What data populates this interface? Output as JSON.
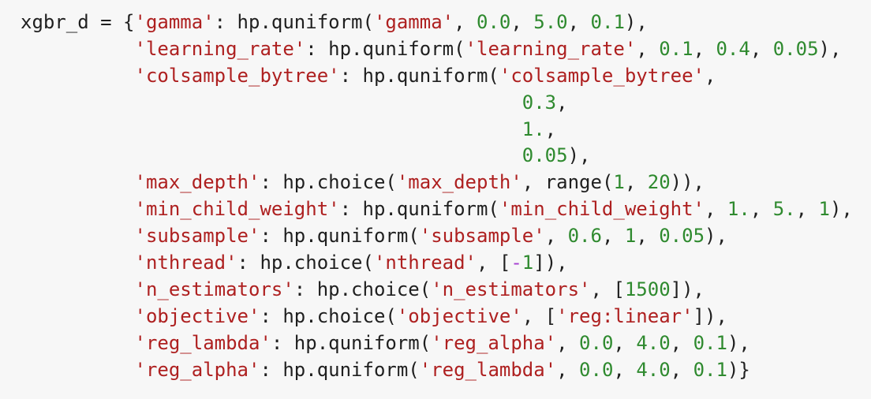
{
  "code_block": {
    "colors": {
      "background": "#f7f7f7",
      "text": "#1f1f1f",
      "string": "#ae2020",
      "number": "#2f8a2f",
      "operator": "#a63fd1"
    },
    "lines": [
      [
        {
          "k": "t",
          "v": "xgbr_d = {"
        },
        {
          "k": "s",
          "v": "'gamma'"
        },
        {
          "k": "t",
          "v": ": hp.quniform("
        },
        {
          "k": "s",
          "v": "'gamma'"
        },
        {
          "k": "t",
          "v": ", "
        },
        {
          "k": "n",
          "v": "0.0"
        },
        {
          "k": "t",
          "v": ", "
        },
        {
          "k": "n",
          "v": "5.0"
        },
        {
          "k": "t",
          "v": ", "
        },
        {
          "k": "n",
          "v": "0.1"
        },
        {
          "k": "t",
          "v": "),"
        }
      ],
      [
        {
          "k": "t",
          "v": "          "
        },
        {
          "k": "s",
          "v": "'learning_rate'"
        },
        {
          "k": "t",
          "v": ": hp.quniform("
        },
        {
          "k": "s",
          "v": "'learning_rate'"
        },
        {
          "k": "t",
          "v": ", "
        },
        {
          "k": "n",
          "v": "0.1"
        },
        {
          "k": "t",
          "v": ", "
        },
        {
          "k": "n",
          "v": "0.4"
        },
        {
          "k": "t",
          "v": ", "
        },
        {
          "k": "n",
          "v": "0.05"
        },
        {
          "k": "t",
          "v": "),"
        }
      ],
      [
        {
          "k": "t",
          "v": "          "
        },
        {
          "k": "s",
          "v": "'colsample_bytree'"
        },
        {
          "k": "t",
          "v": ": hp.quniform("
        },
        {
          "k": "s",
          "v": "'colsample_bytree'"
        },
        {
          "k": "t",
          "v": ","
        }
      ],
      [
        {
          "k": "t",
          "v": "                                            "
        },
        {
          "k": "n",
          "v": "0.3"
        },
        {
          "k": "t",
          "v": ","
        }
      ],
      [
        {
          "k": "t",
          "v": "                                            "
        },
        {
          "k": "n",
          "v": "1."
        },
        {
          "k": "t",
          "v": ","
        }
      ],
      [
        {
          "k": "t",
          "v": "                                            "
        },
        {
          "k": "n",
          "v": "0.05"
        },
        {
          "k": "t",
          "v": "),"
        }
      ],
      [
        {
          "k": "t",
          "v": "          "
        },
        {
          "k": "s",
          "v": "'max_depth'"
        },
        {
          "k": "t",
          "v": ": hp.choice("
        },
        {
          "k": "s",
          "v": "'max_depth'"
        },
        {
          "k": "t",
          "v": ", range("
        },
        {
          "k": "n",
          "v": "1"
        },
        {
          "k": "t",
          "v": ", "
        },
        {
          "k": "n",
          "v": "20"
        },
        {
          "k": "t",
          "v": ")),"
        }
      ],
      [
        {
          "k": "t",
          "v": "          "
        },
        {
          "k": "s",
          "v": "'min_child_weight'"
        },
        {
          "k": "t",
          "v": ": hp.quniform("
        },
        {
          "k": "s",
          "v": "'min_child_weight'"
        },
        {
          "k": "t",
          "v": ", "
        },
        {
          "k": "n",
          "v": "1."
        },
        {
          "k": "t",
          "v": ", "
        },
        {
          "k": "n",
          "v": "5."
        },
        {
          "k": "t",
          "v": ", "
        },
        {
          "k": "n",
          "v": "1"
        },
        {
          "k": "t",
          "v": "),"
        }
      ],
      [
        {
          "k": "t",
          "v": "          "
        },
        {
          "k": "s",
          "v": "'subsample'"
        },
        {
          "k": "t",
          "v": ": hp.quniform("
        },
        {
          "k": "s",
          "v": "'subsample'"
        },
        {
          "k": "t",
          "v": ", "
        },
        {
          "k": "n",
          "v": "0.6"
        },
        {
          "k": "t",
          "v": ", "
        },
        {
          "k": "n",
          "v": "1"
        },
        {
          "k": "t",
          "v": ", "
        },
        {
          "k": "n",
          "v": "0.05"
        },
        {
          "k": "t",
          "v": "),"
        }
      ],
      [
        {
          "k": "t",
          "v": "          "
        },
        {
          "k": "s",
          "v": "'nthread'"
        },
        {
          "k": "t",
          "v": ": hp.choice("
        },
        {
          "k": "s",
          "v": "'nthread'"
        },
        {
          "k": "t",
          "v": ", ["
        },
        {
          "k": "o",
          "v": "-"
        },
        {
          "k": "n",
          "v": "1"
        },
        {
          "k": "t",
          "v": "]),"
        }
      ],
      [
        {
          "k": "t",
          "v": "          "
        },
        {
          "k": "s",
          "v": "'n_estimators'"
        },
        {
          "k": "t",
          "v": ": hp.choice("
        },
        {
          "k": "s",
          "v": "'n_estimators'"
        },
        {
          "k": "t",
          "v": ", ["
        },
        {
          "k": "n",
          "v": "1500"
        },
        {
          "k": "t",
          "v": "]),"
        }
      ],
      [
        {
          "k": "t",
          "v": "          "
        },
        {
          "k": "s",
          "v": "'objective'"
        },
        {
          "k": "t",
          "v": ": hp.choice("
        },
        {
          "k": "s",
          "v": "'objective'"
        },
        {
          "k": "t",
          "v": ", ["
        },
        {
          "k": "s",
          "v": "'reg:linear'"
        },
        {
          "k": "t",
          "v": "]),"
        }
      ],
      [
        {
          "k": "t",
          "v": "          "
        },
        {
          "k": "s",
          "v": "'reg_lambda'"
        },
        {
          "k": "t",
          "v": ": hp.quniform("
        },
        {
          "k": "s",
          "v": "'reg_alpha'"
        },
        {
          "k": "t",
          "v": ", "
        },
        {
          "k": "n",
          "v": "0.0"
        },
        {
          "k": "t",
          "v": ", "
        },
        {
          "k": "n",
          "v": "4.0"
        },
        {
          "k": "t",
          "v": ", "
        },
        {
          "k": "n",
          "v": "0.1"
        },
        {
          "k": "t",
          "v": "),"
        }
      ],
      [
        {
          "k": "t",
          "v": "          "
        },
        {
          "k": "s",
          "v": "'reg_alpha'"
        },
        {
          "k": "t",
          "v": ": hp.quniform("
        },
        {
          "k": "s",
          "v": "'reg_lambda'"
        },
        {
          "k": "t",
          "v": ", "
        },
        {
          "k": "n",
          "v": "0.0"
        },
        {
          "k": "t",
          "v": ", "
        },
        {
          "k": "n",
          "v": "4.0"
        },
        {
          "k": "t",
          "v": ", "
        },
        {
          "k": "n",
          "v": "0.1"
        },
        {
          "k": "t",
          "v": ")}"
        }
      ]
    ]
  }
}
